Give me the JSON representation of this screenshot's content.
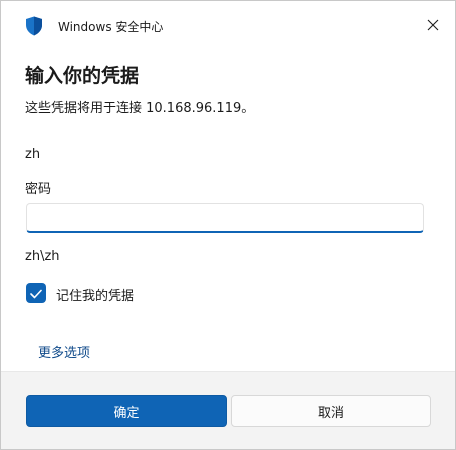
{
  "window": {
    "app_title": "Windows 安全中心",
    "app_icon": "shield-icon",
    "close_icon": "close-icon"
  },
  "dialog": {
    "heading": "输入你的凭据",
    "subtitle": "这些凭据将用于连接 10.168.96.119。",
    "username": "zh",
    "password_label": "密码",
    "password_value": "",
    "domain_user": "zh\\zh",
    "remember_label": "记住我的凭据",
    "remember_checked": true,
    "more_options": "更多选项"
  },
  "footer": {
    "ok_label": "确定",
    "cancel_label": "取消"
  },
  "colors": {
    "accent": "#0f64b5",
    "link": "#0f4a8a",
    "footer_bg": "#f3f3f3"
  }
}
